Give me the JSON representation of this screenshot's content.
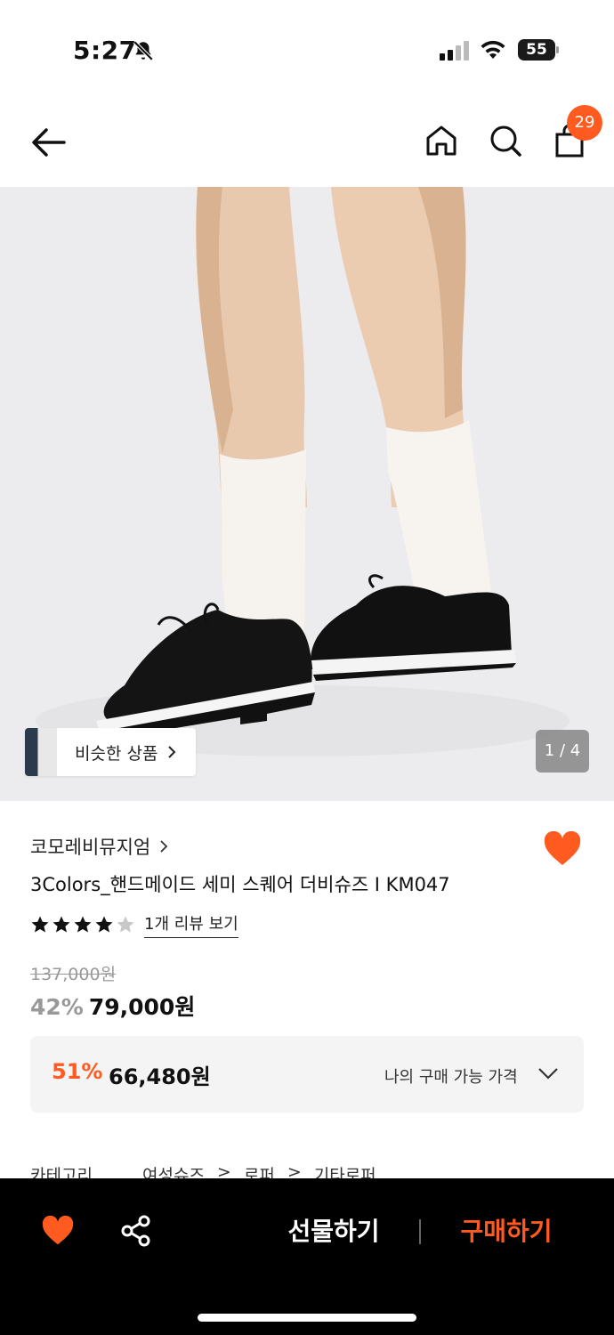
{
  "status_bar": {
    "time": "5:27",
    "battery": "55",
    "icons": [
      "bell-slash-icon",
      "signal-icon",
      "wifi-icon",
      "battery-icon"
    ]
  },
  "nav": {
    "icons": [
      "back-arrow-icon",
      "home-icon",
      "search-icon",
      "shopping-bag-icon"
    ],
    "cart_count": "29"
  },
  "gallery": {
    "similar_label": "비슷한 상품",
    "counter": "1 / 4"
  },
  "product": {
    "brand": "코모레비뮤지엄",
    "title": "3Colors_핸드메이드 세미 스퀘어 더비슈즈 I KM047",
    "rating": 4,
    "rating_max": 5,
    "review_link": "1개 리뷰 보기",
    "original_price": "137,000원",
    "discount_rate": "42%",
    "sale_price": "79,000원"
  },
  "my_price": {
    "discount": "51%",
    "price": "66,480원",
    "label": "나의 구매 가능 가격"
  },
  "category": {
    "label": "카테고리",
    "path": [
      "여성슈즈",
      "로퍼",
      "기타로퍼"
    ]
  },
  "bottom_bar": {
    "gift_label": "선물하기",
    "buy_label": "구매하기"
  },
  "colors": {
    "accent": "#ff5a1f",
    "bottom_bar_bg": "#000000",
    "price_box_bg": "#f4f4f5"
  }
}
